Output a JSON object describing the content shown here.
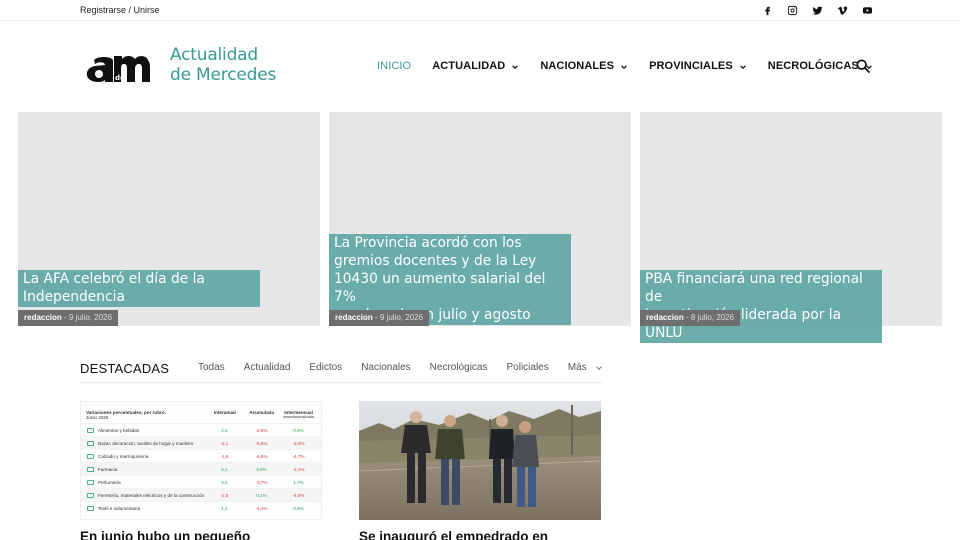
{
  "topbar": {
    "register": "Registrarse",
    "separator": " / ",
    "join": "Unirse",
    "social_icons": [
      "facebook-icon",
      "instagram-icon",
      "twitter-icon",
      "vimeo-icon",
      "youtube-icon"
    ]
  },
  "logo": {
    "mark_text": "am",
    "mark_small": "de",
    "line1": "Actualidad",
    "line2": "de Mercedes",
    "color": "#3a9a97"
  },
  "nav": {
    "items": [
      {
        "label": "INICIO",
        "active": true
      },
      {
        "label": "ACTUALIDAD"
      },
      {
        "label": "NACIONALES"
      },
      {
        "label": "PROVINCIALES"
      },
      {
        "label": "NECROLÓGICAS"
      }
    ],
    "search_icon": "search-icon"
  },
  "hero": [
    {
      "title_lines": [
        "La AFA celebró el día de la",
        "Independencia"
      ],
      "author": "redaccion",
      "date": "9 julio, 2026"
    },
    {
      "title_lines": [
        "La Provincia acordó con los",
        "gremios docentes y de la Ley",
        "10430 un aumento salarial del 7%",
        "escalonado en julio y agosto"
      ],
      "author": "redaccion",
      "date": "9 julio, 2026"
    },
    {
      "title_lines": [
        "PBA financiará una red regional de",
        "investigación liderada por la UNLU"
      ],
      "author": "redaccion",
      "date": "8 julio, 2026"
    }
  ],
  "destacadas": {
    "title": "DESTACADAS",
    "tabs": [
      "Todas",
      "Actualidad",
      "Edictos",
      "Nacionales",
      "Necrológicas",
      "Policiales"
    ],
    "more": "Más"
  },
  "thumb_table": {
    "title": "Variaciones porcentuales, por rubro.",
    "subtitle": "Junio 2026",
    "headers": [
      "Interanual",
      "Acumulada",
      "Intermensual"
    ],
    "header_sub": "desestacionalizada",
    "rows": [
      {
        "label": "Alimentos y bebidas",
        "v": [
          "2,5",
          "-2,8%",
          "0,9%"
        ]
      },
      {
        "label": "Bazar, decoración, textiles de hogar y muebles",
        "v": [
          "-2,1",
          "-5,8%",
          "-3,4%"
        ]
      },
      {
        "label": "Calzado y marroquinería",
        "v": [
          "-1,6",
          "-9,8%",
          "-4,7%"
        ]
      },
      {
        "label": "Farmacia",
        "v": [
          "5,1",
          "4,9%",
          "-3,1%"
        ]
      },
      {
        "label": "Perfumería",
        "v": [
          "8,5",
          "-3,7%",
          "1,7%"
        ]
      },
      {
        "label": "Ferretería, materiales eléctricos y de la construcción",
        "v": [
          "-2,8",
          "0,1%",
          "-4,8%"
        ]
      },
      {
        "label": "Textil e indumentaria",
        "v": [
          "1,2",
          "-4,4%",
          "0,8%"
        ]
      }
    ]
  },
  "articles": [
    {
      "title": "En junio hubo un pequeño"
    },
    {
      "title": "Se inauguró el empedrado en"
    }
  ]
}
